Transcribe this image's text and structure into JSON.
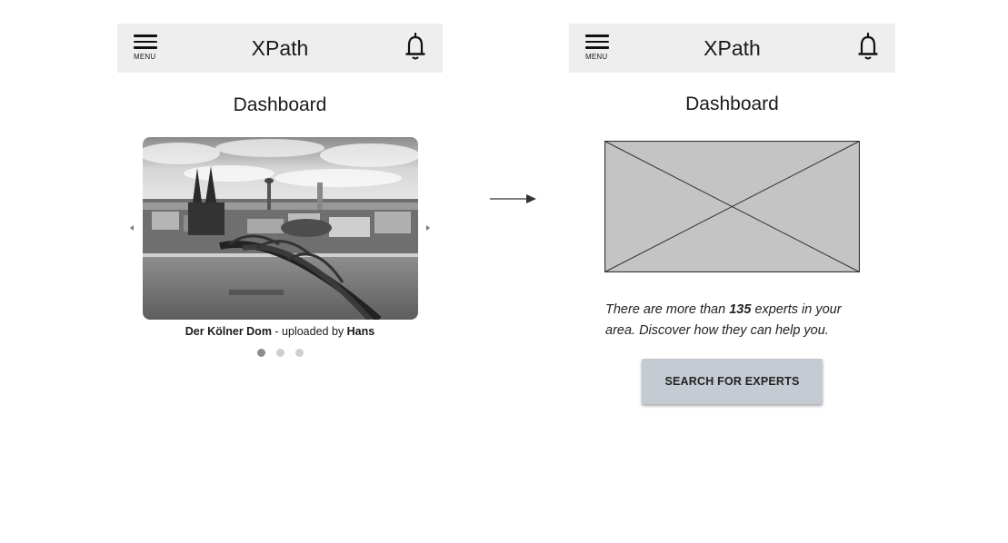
{
  "left_screen": {
    "appbar": {
      "menu_label": "MENU",
      "title": "XPath",
      "menu_icon": "hamburger-menu-icon",
      "bell_icon": "bell-icon"
    },
    "page_title": "Dashboard",
    "carousel": {
      "image_alt": "Der Kölner Dom",
      "caption": {
        "title": "Der Kölner Dom",
        "middle": " - uploaded by ",
        "author": "Hans"
      },
      "slide_count": 3,
      "active_slide": 1,
      "prev_icon": "caret-left-icon",
      "next_icon": "caret-right-icon"
    }
  },
  "flow": {
    "icon": "right-arrow-icon"
  },
  "right_screen": {
    "appbar": {
      "menu_label": "MENU",
      "title": "XPath",
      "menu_icon": "hamburger-menu-icon",
      "bell_icon": "bell-icon"
    },
    "page_title": "Dashboard",
    "image_placeholder": "image-placeholder",
    "info": {
      "before": "There are more than ",
      "count": "135",
      "after": " experts in your area. Discover how they can help you."
    },
    "search_button": "SEARCH FOR EXPERTS"
  },
  "colors": {
    "appbar_bg": "#eeeeee",
    "button_bg": "#c5cbd2",
    "placeholder_fill": "#c4c4c4",
    "dot_active": "#8c8c8c",
    "dot_inactive": "#cfcfcf"
  }
}
